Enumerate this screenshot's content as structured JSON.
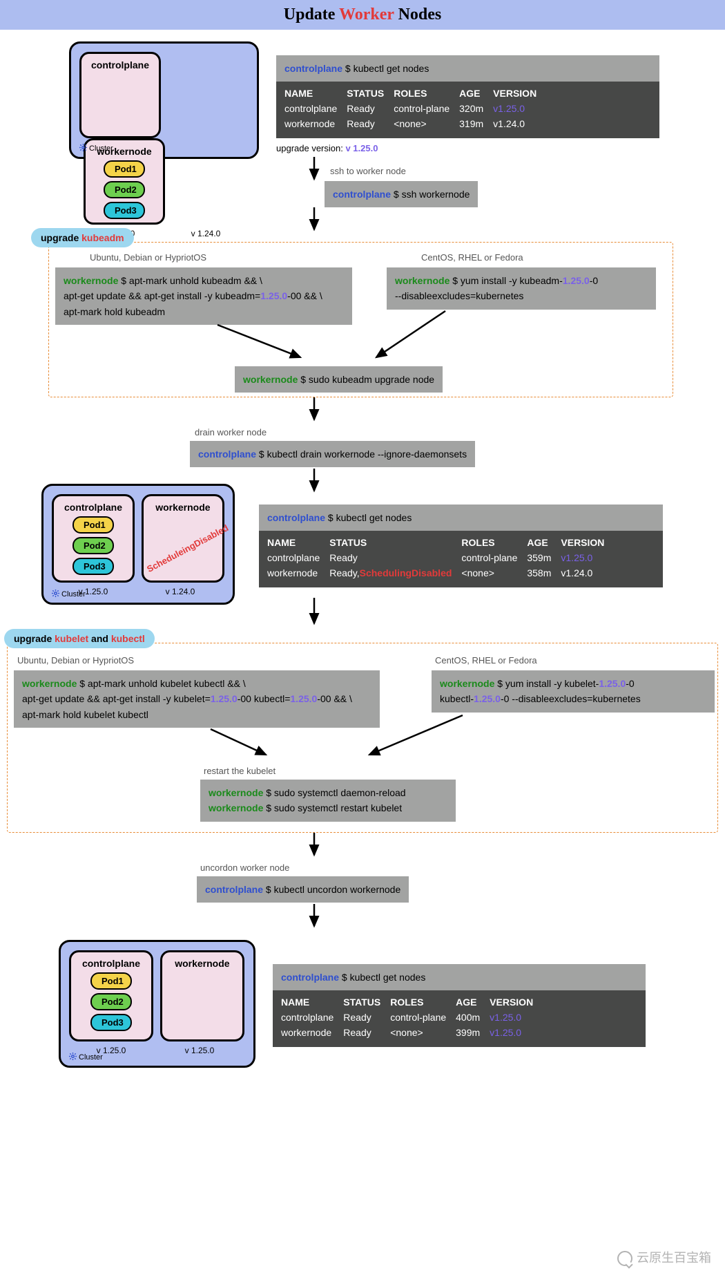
{
  "title": {
    "t1": "Update ",
    "t2": "Worker",
    "t3": " Nodes"
  },
  "pods": {
    "p1": "Pod1",
    "p2": "Pod2",
    "p3": "Pod3"
  },
  "labels": {
    "controlplane": "controlplane",
    "workernode": "workernode",
    "cluster": "Cluster"
  },
  "cluster1": {
    "cp_ver": "v 1.25.0",
    "wn_ver": "v 1.24.0"
  },
  "cluster2": {
    "cp_ver": "v 1.25.0",
    "wn_ver": "v 1.24.0"
  },
  "cluster3": {
    "cp_ver": "v 1.25.0",
    "wn_ver": "v 1.25.0"
  },
  "sched_disabled": "ScheduleingDisabled",
  "cmd1": {
    "host": "controlplane",
    "dollar": " $ ",
    "text": "kubectl get nodes"
  },
  "table1": {
    "h": [
      "NAME",
      "STATUS",
      "ROLES",
      "AGE",
      "VERSION"
    ],
    "r1": [
      "controlplane",
      "Ready",
      "control-plane",
      "320m",
      "v1.25.0"
    ],
    "r2": [
      "workernode",
      "Ready",
      "<none>",
      "319m",
      "v1.24.0"
    ]
  },
  "upgrade_line": {
    "pre": "upgrade version: ",
    "ver": "v 1.25.0"
  },
  "ssh_caption": "ssh to worker node",
  "ssh_cmd": {
    "host": "controlplane",
    "text": " $ ssh workernode"
  },
  "tag_kubeadm": {
    "pre": "upgrade ",
    "kw": "kubeadm"
  },
  "ubuntu_h": "Ubuntu, Debian or HypriotOS",
  "centos_h": "CentOS, RHEL or Fedora",
  "kubeadm_apt": {
    "host": "workernode",
    "l1": " $ apt-mark unhold kubeadm && \\",
    "l2a": "apt-get update && apt-get install -y kubeadm=",
    "l2v": "1.25.0",
    "l2b": "-00 && \\",
    "l3": "apt-mark hold kubeadm"
  },
  "kubeadm_yum": {
    "host": "workernode",
    "l1a": " $ yum install -y kubeadm-",
    "l1v": "1.25.0",
    "l1b": "-0",
    "l2": "--disableexcludes=kubernetes"
  },
  "upgrade_node_cmd": {
    "host": "workernode",
    "text": " $ sudo kubeadm upgrade node"
  },
  "drain_caption": "drain worker node",
  "drain_cmd": {
    "host": "controlplane",
    "text": " $ kubectl drain workernode --ignore-daemonsets"
  },
  "cmd2": {
    "host": "controlplane",
    "text": " $ kubectl get nodes"
  },
  "table2": {
    "h": [
      "NAME",
      "STATUS",
      "ROLES",
      "AGE",
      "VERSION"
    ],
    "r1": [
      "controlplane",
      "Ready",
      "control-plane",
      "359m",
      "v1.25.0"
    ],
    "r2": {
      "name": "workernode",
      "status_a": "Ready,",
      "status_b": "SchedulingDisabled",
      "roles": "<none>",
      "age": "358m",
      "ver": "v1.24.0"
    }
  },
  "tag_kubelet": {
    "pre": "upgrade ",
    "kw1": "kubelet",
    "and": " and ",
    "kw2": "kubectl"
  },
  "kubelet_apt": {
    "host": "workernode",
    "l1": " $ apt-mark unhold kubelet kubectl && \\",
    "l2a": "apt-get update && apt-get install -y kubelet=",
    "l2v1": "1.25.0",
    "l2b": "-00 kubectl=",
    "l2v2": "1.25.0",
    "l2c": "-00 && \\",
    "l3": "apt-mark hold kubelet kubectl"
  },
  "kubelet_yum": {
    "host": "workernode",
    "l1a": " $ yum install -y kubelet-",
    "l1v": "1.25.0",
    "l1b": "-0",
    "l2a": "kubectl-",
    "l2v": "1.25.0",
    "l2b": "-0 --disableexcludes=kubernetes"
  },
  "restart_caption": "restart the kubelet",
  "restart_cmd1": {
    "host": "workernode",
    "text": " $ sudo systemctl daemon-reload"
  },
  "restart_cmd2": {
    "host": "workernode",
    "text": " $ sudo systemctl restart kubelet"
  },
  "uncordon_caption": "uncordon worker node",
  "uncordon_cmd": {
    "host": "controlplane",
    "text": " $ kubectl uncordon workernode"
  },
  "cmd3": {
    "host": "controlplane",
    "text": " $ kubectl get nodes"
  },
  "table3": {
    "h": [
      "NAME",
      "STATUS",
      "ROLES",
      "AGE",
      "VERSION"
    ],
    "r1": [
      "controlplane",
      "Ready",
      "control-plane",
      "400m",
      "v1.25.0"
    ],
    "r2": [
      "workernode",
      "Ready",
      "<none>",
      "399m",
      "v1.25.0"
    ]
  },
  "watermark": "云原生百宝箱"
}
